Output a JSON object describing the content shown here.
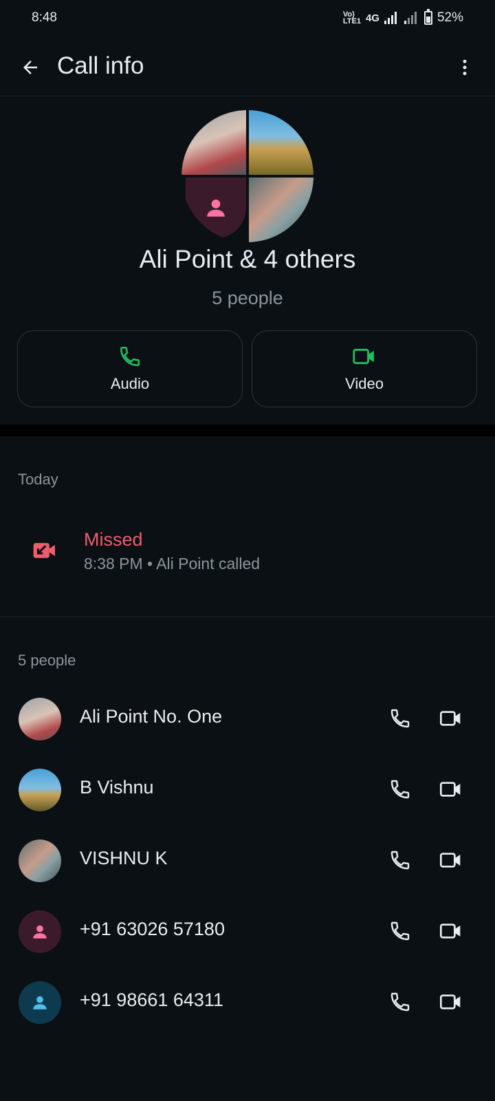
{
  "status_bar": {
    "time": "8:48",
    "volte": "Vo)",
    "lte": "LTE1",
    "network": "4G",
    "battery": "52%"
  },
  "app_bar": {
    "title": "Call info"
  },
  "group": {
    "name": "Ali Point & 4 others",
    "count": "5 people"
  },
  "actions": {
    "audio_label": "Audio",
    "video_label": "Video",
    "accent": "#21c063"
  },
  "history": {
    "section_label": "Today",
    "entries": [
      {
        "status": "Missed",
        "detail": "8:38 PM • Ali Point called",
        "status_color": "#f15c6d",
        "icon": "missed-video-call-icon"
      }
    ]
  },
  "participants": {
    "section_label": "5 people",
    "list": [
      {
        "name": "Ali Point No. One"
      },
      {
        "name": "B Vishnu"
      },
      {
        "name": "VISHNU K"
      },
      {
        "name": "+91 63026 57180"
      },
      {
        "name": "+91 98661 64311"
      }
    ]
  }
}
